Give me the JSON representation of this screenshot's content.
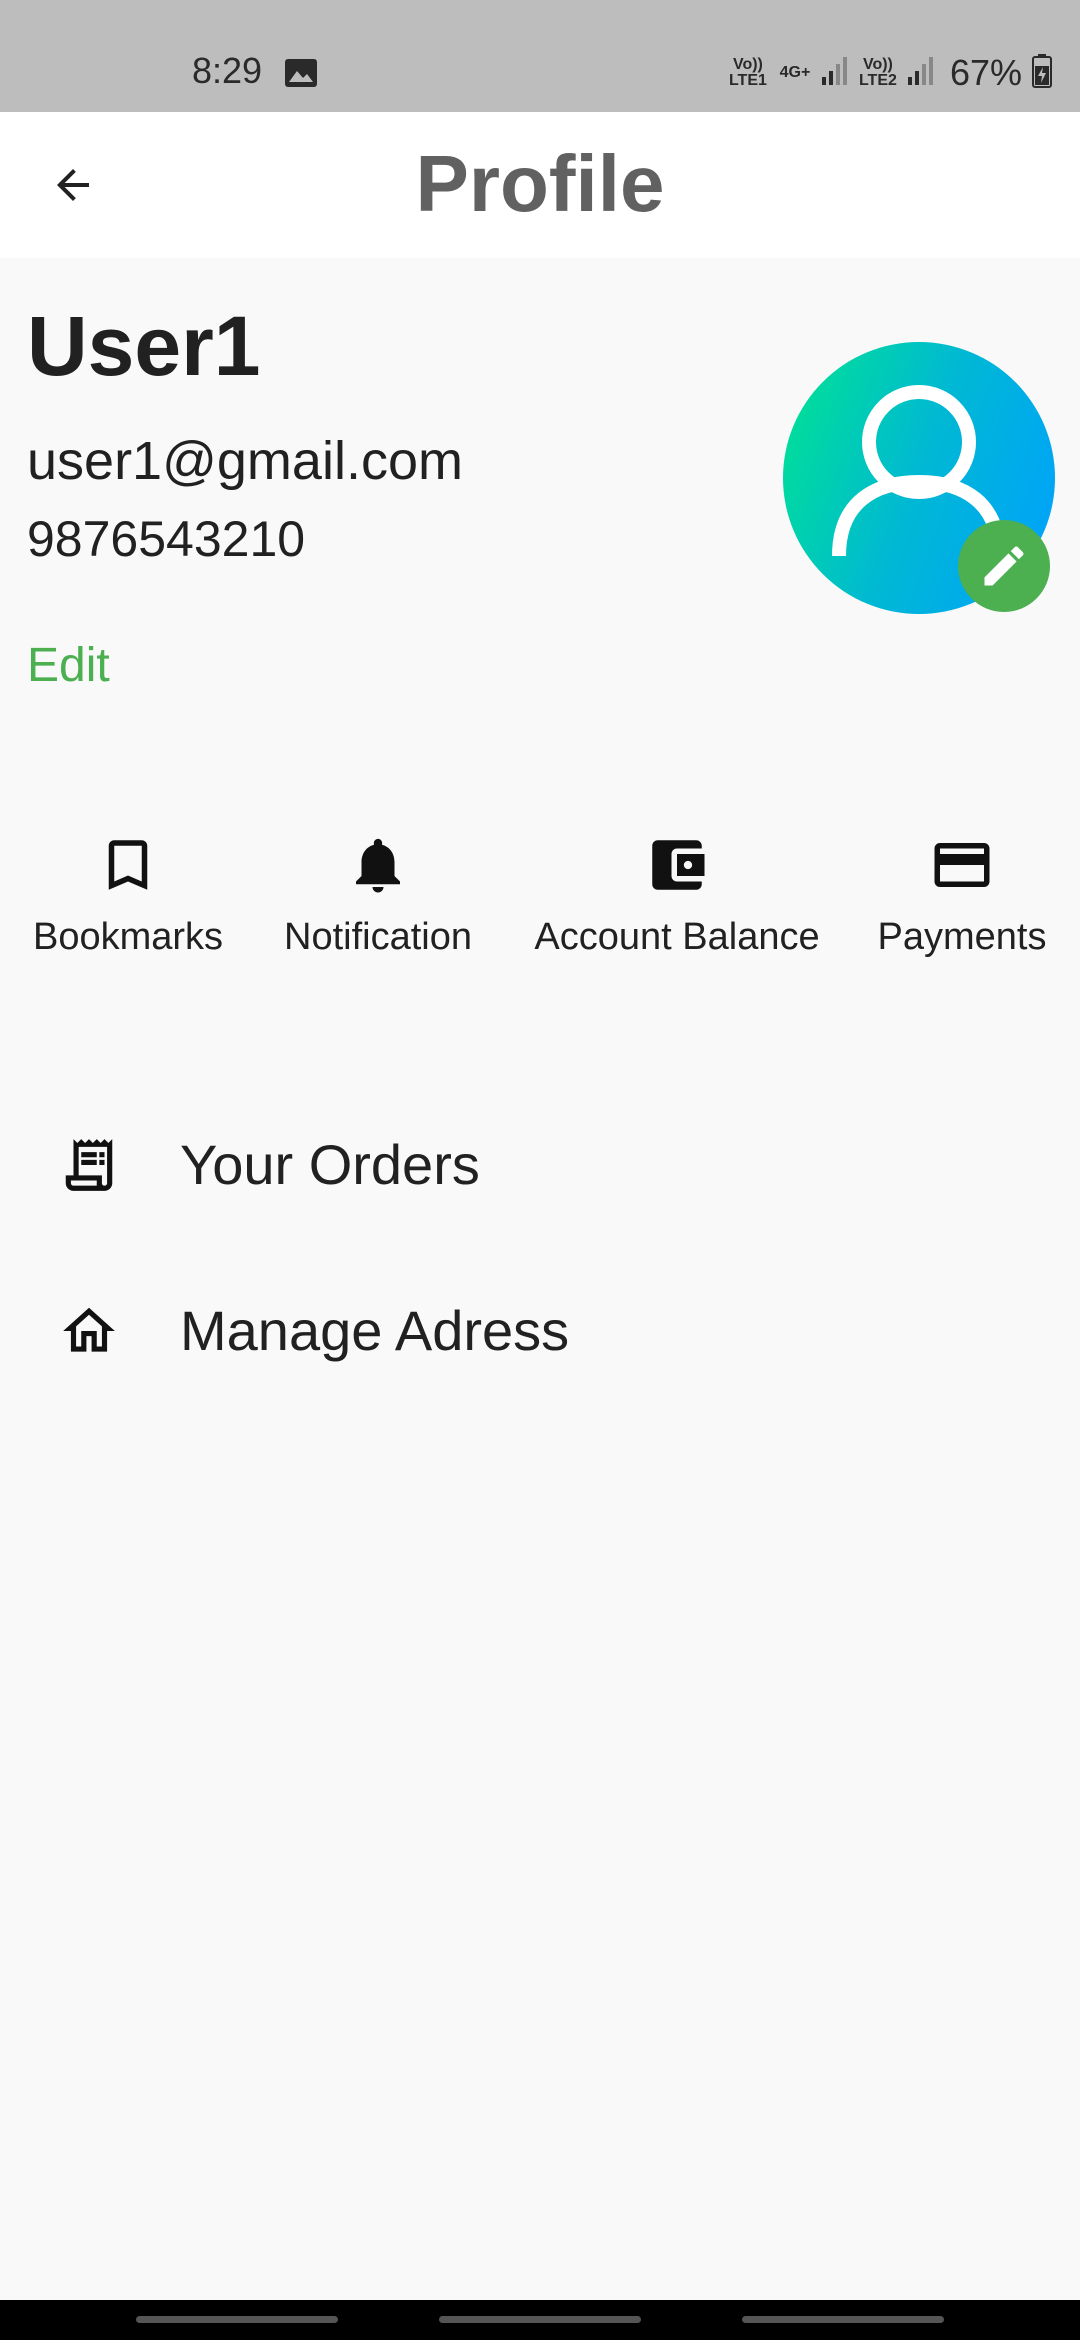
{
  "status_bar": {
    "time": "8:29",
    "net1": "Vo)) LTE1",
    "net_type": "4G+",
    "net2": "Vo)) LTE2",
    "battery": "67%"
  },
  "app_bar": {
    "title": "Profile",
    "back_icon": "arrow-back-icon"
  },
  "profile": {
    "name": "User1",
    "email": "user1@gmail.com",
    "phone": "9876543210",
    "edit_label": "Edit",
    "avatar_gradient": [
      "#00e58f",
      "#00a0ff"
    ],
    "edit_badge_color": "#4caf50"
  },
  "quick_actions": [
    {
      "label": "Bookmarks",
      "icon": "bookmark-icon"
    },
    {
      "label": "Notification",
      "icon": "bell-icon"
    },
    {
      "label": "Account Balance",
      "icon": "wallet-icon"
    },
    {
      "label": "Payments",
      "icon": "credit-card-icon"
    }
  ],
  "menu": [
    {
      "label": "Your Orders",
      "icon": "receipt-icon"
    },
    {
      "label": "Manage Adress",
      "icon": "home-icon"
    }
  ],
  "colors": {
    "accent": "#4caf50",
    "title": "#616161",
    "status_bar": "#bdbdbd"
  }
}
